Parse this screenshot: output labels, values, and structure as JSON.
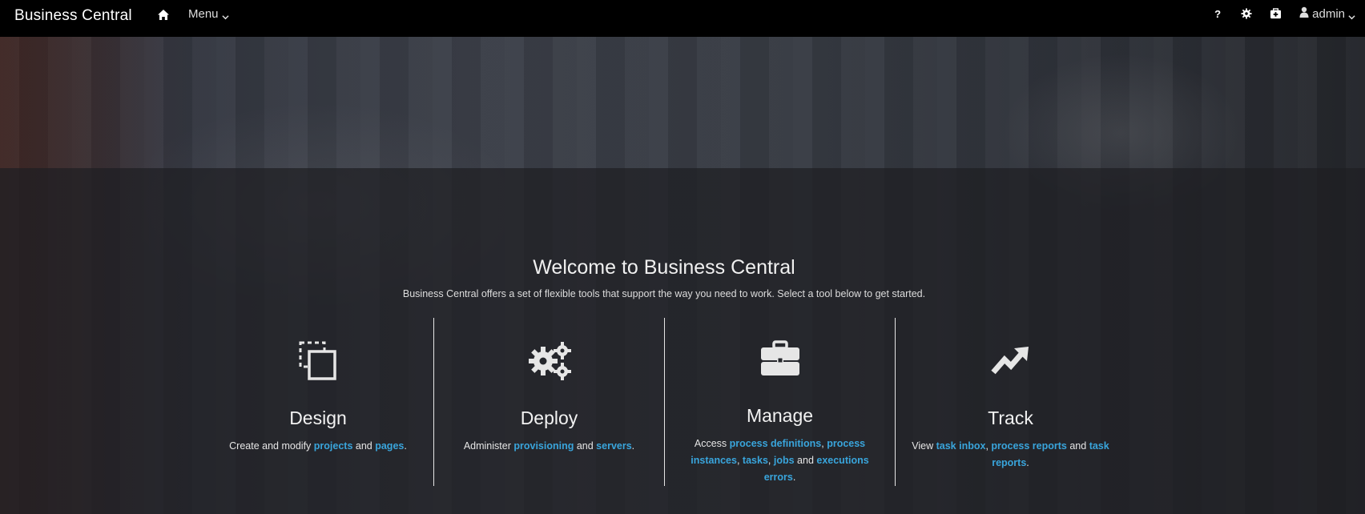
{
  "navbar": {
    "brand": "Business Central",
    "menu_label": "Menu",
    "help_label": "?",
    "user_label": "admin"
  },
  "welcome": {
    "title": "Welcome to Business Central",
    "subtitle": "Business Central offers a set of flexible tools that support the way you need to work. Select a tool below to get started."
  },
  "tiles": {
    "design": {
      "title": "Design",
      "text1": "Create and modify ",
      "link1": "projects",
      "text2": " and ",
      "link2": "pages",
      "text3": "."
    },
    "deploy": {
      "title": "Deploy",
      "text1": "Administer ",
      "link1": "provisioning",
      "text2": " and ",
      "link2": "servers",
      "text3": "."
    },
    "manage": {
      "title": "Manage",
      "text1": "Access ",
      "link1": "process definitions",
      "text2": ", ",
      "link2": "process instances",
      "text3": ", ",
      "link3": "tasks",
      "text4": ", ",
      "link4": "jobs",
      "text5": " and ",
      "link5": "executions errors",
      "text6": "."
    },
    "track": {
      "title": "Track",
      "text1": "View ",
      "link1": "task inbox",
      "text2": ", ",
      "link2": "process reports",
      "text3": " and ",
      "link3": "task reports",
      "text4": "."
    }
  },
  "icons": {
    "home": "home-icon",
    "help": "question-icon",
    "settings": "gear-icon",
    "apps": "medkit-icon",
    "user": "user-icon",
    "design": "copy-icon",
    "deploy": "gears-icon",
    "manage": "briefcase-icon",
    "track": "trend-up-icon"
  },
  "colors": {
    "navbar": "#000000",
    "link": "#39a5dc",
    "text": "#e8e8e8"
  }
}
